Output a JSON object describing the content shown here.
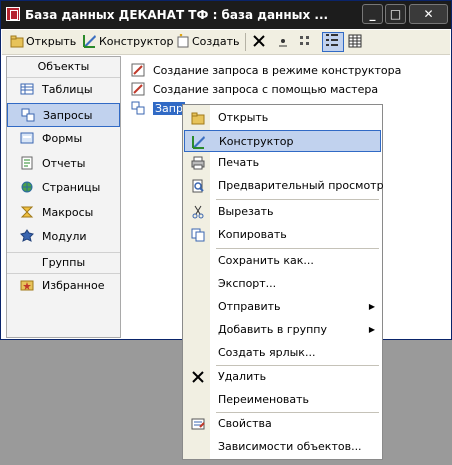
{
  "window": {
    "title": "База данных ДЕКАНАТ ТФ : база данных ..."
  },
  "toolbar": {
    "open_label": "Открыть",
    "design_label": "Конструктор",
    "create_label": "Создать"
  },
  "sidebar": {
    "header": "Объекты",
    "items": [
      {
        "label": "Таблицы",
        "icon": "table-icon"
      },
      {
        "label": "Запросы",
        "icon": "query-icon",
        "selected": true
      },
      {
        "label": "Формы",
        "icon": "form-icon"
      },
      {
        "label": "Отчеты",
        "icon": "report-icon"
      },
      {
        "label": "Страницы",
        "icon": "page-icon"
      },
      {
        "label": "Макросы",
        "icon": "macro-icon"
      },
      {
        "label": "Модули",
        "icon": "module-icon"
      }
    ],
    "groups_header": "Группы",
    "favorites_label": "Избранное"
  },
  "objects": {
    "items": [
      {
        "label": "Создание запроса в режиме конструктора"
      },
      {
        "label": "Создание запроса с помощью мастера"
      },
      {
        "label": "Запр"
      }
    ]
  },
  "context_menu": {
    "items": [
      {
        "label": "Открыть"
      },
      {
        "label": "Конструктор"
      },
      {
        "label": "Печать"
      },
      {
        "label": "Предварительный просмотр"
      },
      {
        "label": "Вырезать"
      },
      {
        "label": "Копировать"
      },
      {
        "label": "Сохранить как..."
      },
      {
        "label": "Экспорт..."
      },
      {
        "label": "Отправить"
      },
      {
        "label": "Добавить в группу"
      },
      {
        "label": "Создать ярлык..."
      },
      {
        "label": "Удалить"
      },
      {
        "label": "Переименовать"
      },
      {
        "label": "Свойства"
      },
      {
        "label": "Зависимости объектов..."
      }
    ]
  },
  "colors": {
    "selection": "#316ac5",
    "highlight": "#c1d2ee",
    "titlebar": "#1c1c1c"
  }
}
